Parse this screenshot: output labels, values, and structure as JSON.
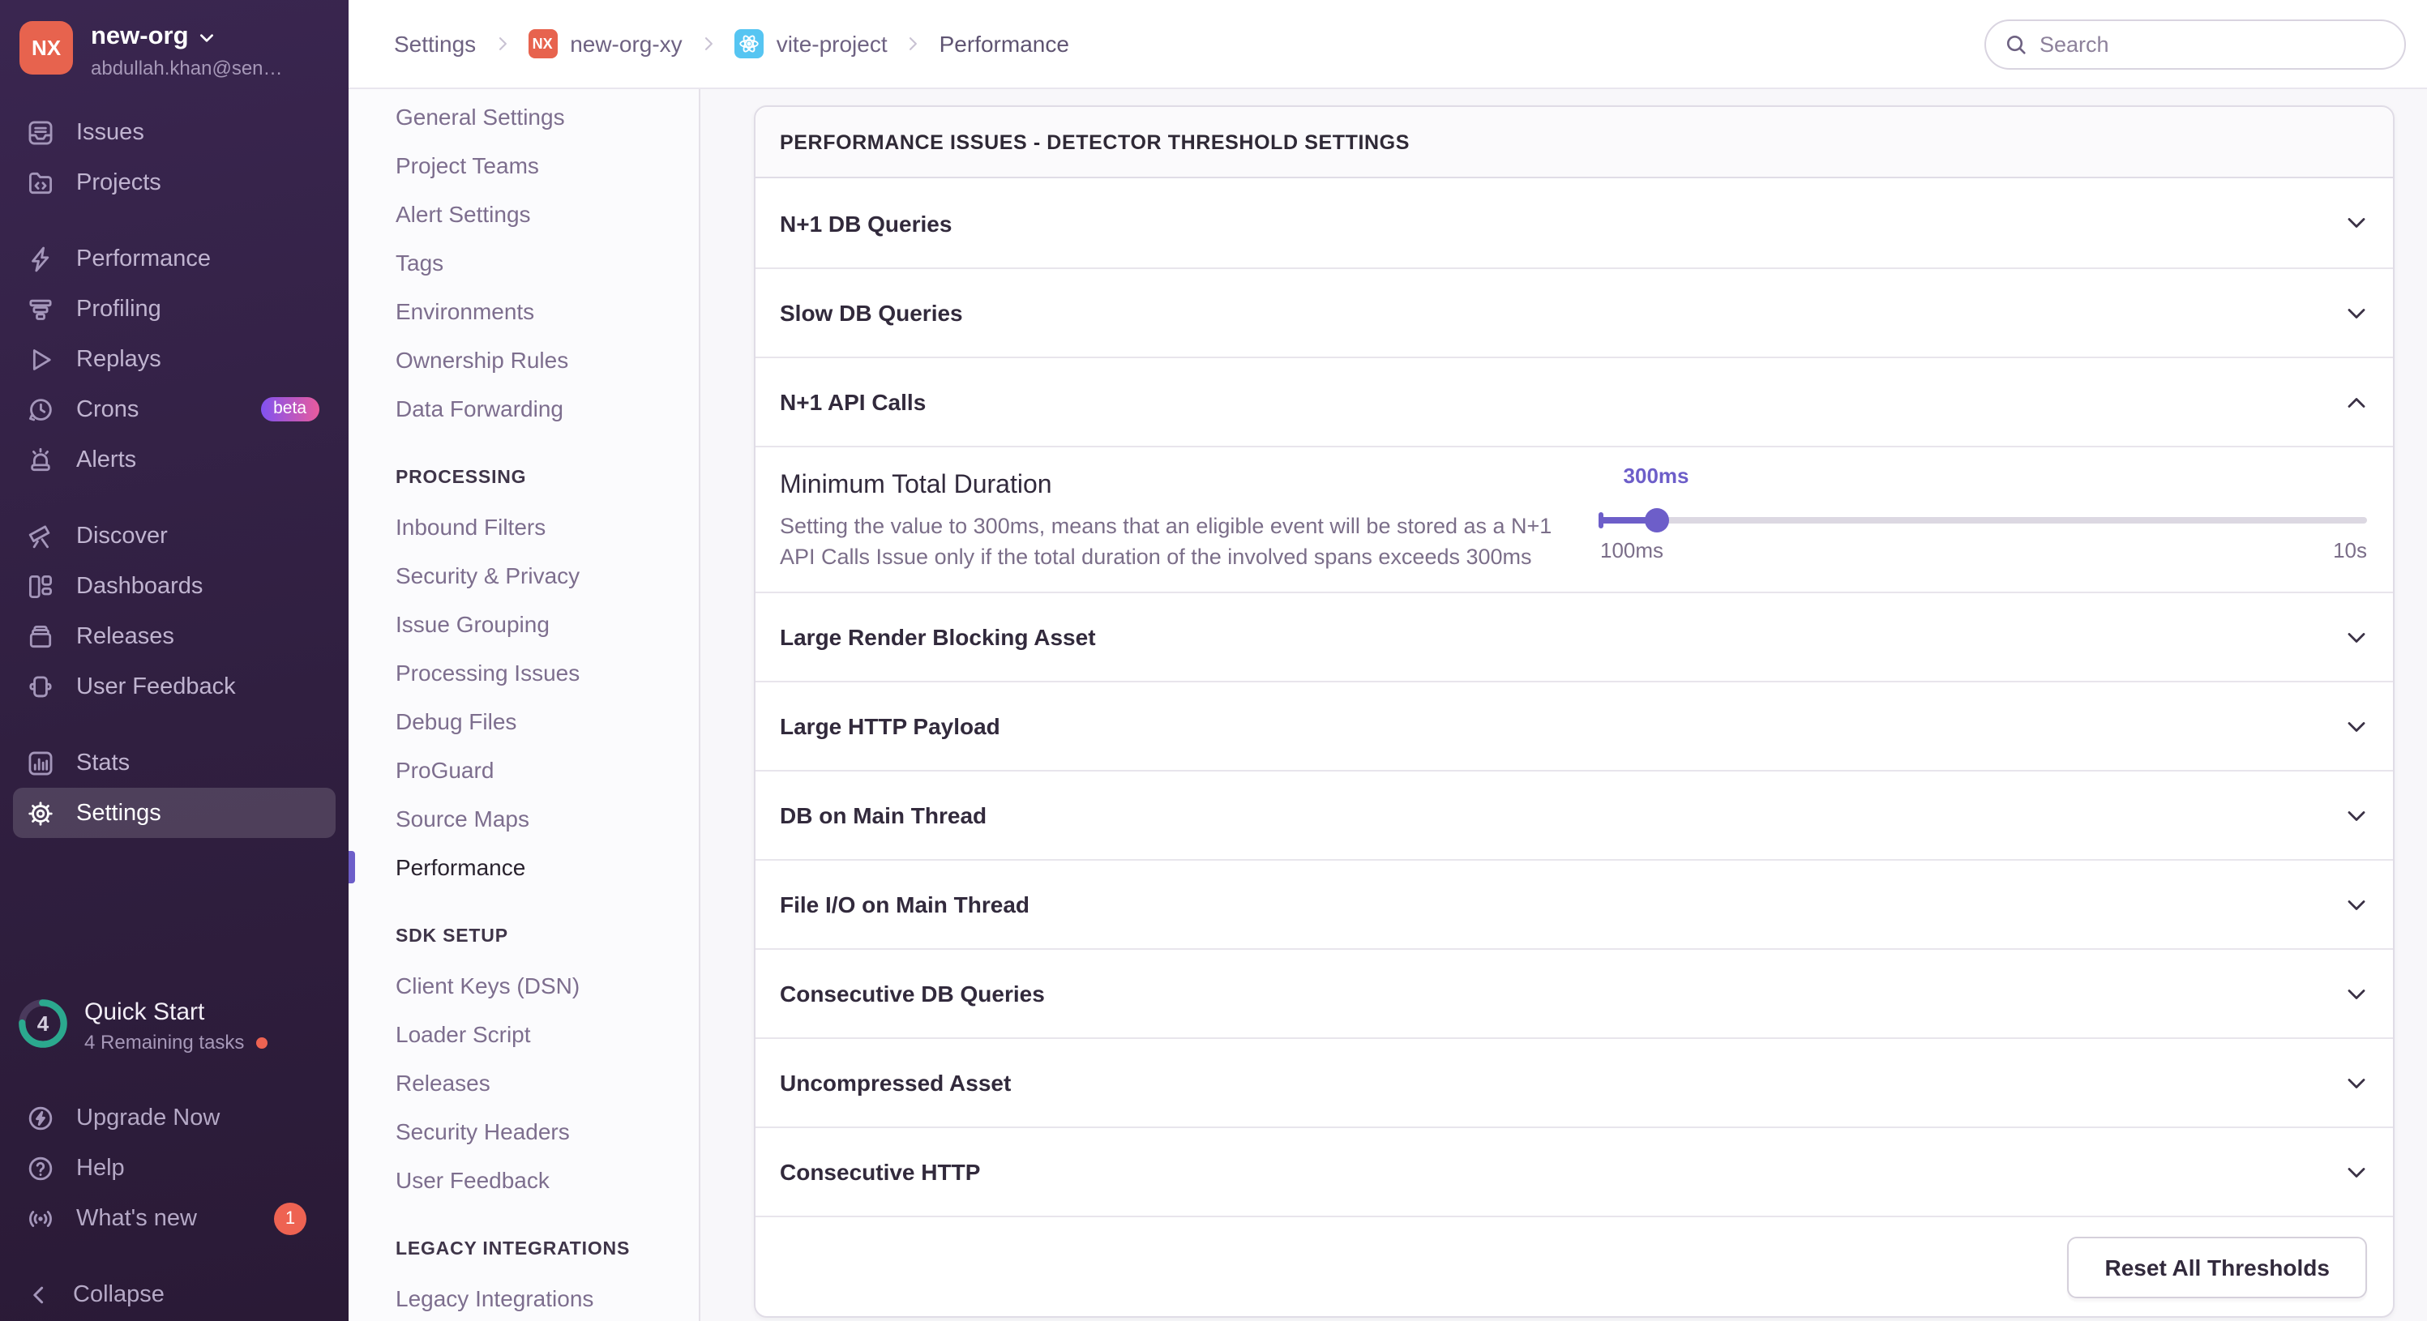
{
  "sidebar": {
    "org": {
      "initials": "NX",
      "name": "new-org",
      "email": "abdullah.khan@sen…"
    },
    "nav_primary": [
      {
        "label": "Issues",
        "icon": "issues-icon"
      },
      {
        "label": "Projects",
        "icon": "projects-icon"
      },
      {
        "label": "Performance",
        "icon": "performance-icon",
        "group_start": true
      },
      {
        "label": "Profiling",
        "icon": "profiling-icon"
      },
      {
        "label": "Replays",
        "icon": "replays-icon"
      },
      {
        "label": "Crons",
        "icon": "crons-icon",
        "badge": "beta"
      },
      {
        "label": "Alerts",
        "icon": "alerts-icon"
      },
      {
        "label": "Discover",
        "icon": "discover-icon",
        "group_start": true
      },
      {
        "label": "Dashboards",
        "icon": "dashboards-icon"
      },
      {
        "label": "Releases",
        "icon": "releases-icon"
      },
      {
        "label": "User Feedback",
        "icon": "user-feedback-icon"
      },
      {
        "label": "Stats",
        "icon": "stats-icon",
        "group_start": true
      },
      {
        "label": "Settings",
        "icon": "gear-icon",
        "active": true
      }
    ],
    "quick_start": {
      "count": "4",
      "title": "Quick Start",
      "subtitle": "4 Remaining tasks"
    },
    "nav_footer": [
      {
        "label": "Upgrade Now",
        "icon": "upgrade-icon"
      },
      {
        "label": "Help",
        "icon": "help-icon"
      },
      {
        "label": "What's new",
        "icon": "broadcast-icon",
        "badge_count": "1"
      }
    ],
    "collapse_label": "Collapse"
  },
  "breadcrumbs": {
    "items": [
      {
        "label": "Settings"
      },
      {
        "label": "new-org-xy",
        "badge": "nx",
        "badge_text": "NX"
      },
      {
        "label": "vite-project",
        "badge": "react"
      },
      {
        "label": "Performance",
        "current": true
      }
    ]
  },
  "search": {
    "placeholder": "Search"
  },
  "settings_nav": {
    "active": "Performance",
    "groups": [
      {
        "heading": null,
        "items": [
          "General Settings",
          "Project Teams",
          "Alert Settings",
          "Tags",
          "Environments",
          "Ownership Rules",
          "Data Forwarding"
        ]
      },
      {
        "heading": "PROCESSING",
        "items": [
          "Inbound Filters",
          "Security & Privacy",
          "Issue Grouping",
          "Processing Issues",
          "Debug Files",
          "ProGuard",
          "Source Maps",
          "Performance"
        ]
      },
      {
        "heading": "SDK SETUP",
        "items": [
          "Client Keys (DSN)",
          "Loader Script",
          "Releases",
          "Security Headers",
          "User Feedback"
        ]
      },
      {
        "heading": "LEGACY INTEGRATIONS",
        "items": [
          "Legacy Integrations"
        ]
      }
    ]
  },
  "panel": {
    "title": "PERFORMANCE ISSUES - DETECTOR THRESHOLD SETTINGS",
    "rows": [
      {
        "label": "N+1 DB Queries"
      },
      {
        "label": "Slow DB Queries"
      },
      {
        "label": "N+1 API Calls",
        "expanded": true
      },
      {
        "label": "Large Render Blocking Asset"
      },
      {
        "label": "Large HTTP Payload"
      },
      {
        "label": "DB on Main Thread"
      },
      {
        "label": "File I/O on Main Thread"
      },
      {
        "label": "Consecutive DB Queries"
      },
      {
        "label": "Uncompressed Asset"
      },
      {
        "label": "Consecutive HTTP"
      }
    ],
    "detail": {
      "setting_label": "Minimum Total Duration",
      "setting_description": "Setting the value to 300ms, means that an eligible event will be stored as a N+1 API Calls Issue only if the total duration of the involved spans exceeds 300ms",
      "slider": {
        "value": "300ms",
        "min": "100ms",
        "max": "10s",
        "percent": 7.3
      }
    },
    "reset_label": "Reset All Thresholds"
  },
  "colors": {
    "accent_purple": "#6D5EC9",
    "coral": "#EE6352",
    "avatar_coral": "#E7634E",
    "teal_progress": "#2BA98E",
    "beta_gradient_from": "#8052F0",
    "beta_gradient_to": "#E95B9D",
    "react_badge_bg": "#56C5F2",
    "sidebar_bg": "#32203F"
  }
}
